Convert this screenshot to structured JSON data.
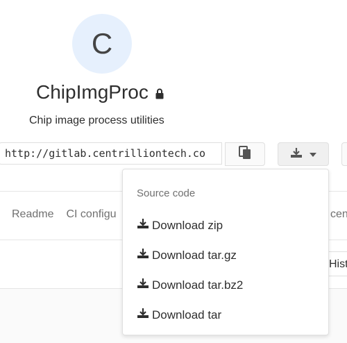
{
  "project": {
    "avatar_letter": "C",
    "name": "ChipImgProc",
    "description": "Chip image process utilities"
  },
  "clone": {
    "url": "http://gitlab.centrilliontech.co"
  },
  "tabs": {
    "readme": "Readme",
    "ci": "CI configu",
    "right_partial": "cen"
  },
  "history_label": "Hist",
  "dropdown": {
    "header": "Source code",
    "items": [
      "Download zip",
      "Download tar.gz",
      "Download tar.bz2",
      "Download tar"
    ]
  },
  "colors": {
    "avatar_bg": "#e6f0fd",
    "text": "#2e2e2e",
    "muted": "#707070",
    "border": "#dfdfdf"
  },
  "icons": {
    "lock": "lock-icon",
    "copy": "copy-icon",
    "download": "download-icon",
    "caret": "caret-down-icon"
  }
}
